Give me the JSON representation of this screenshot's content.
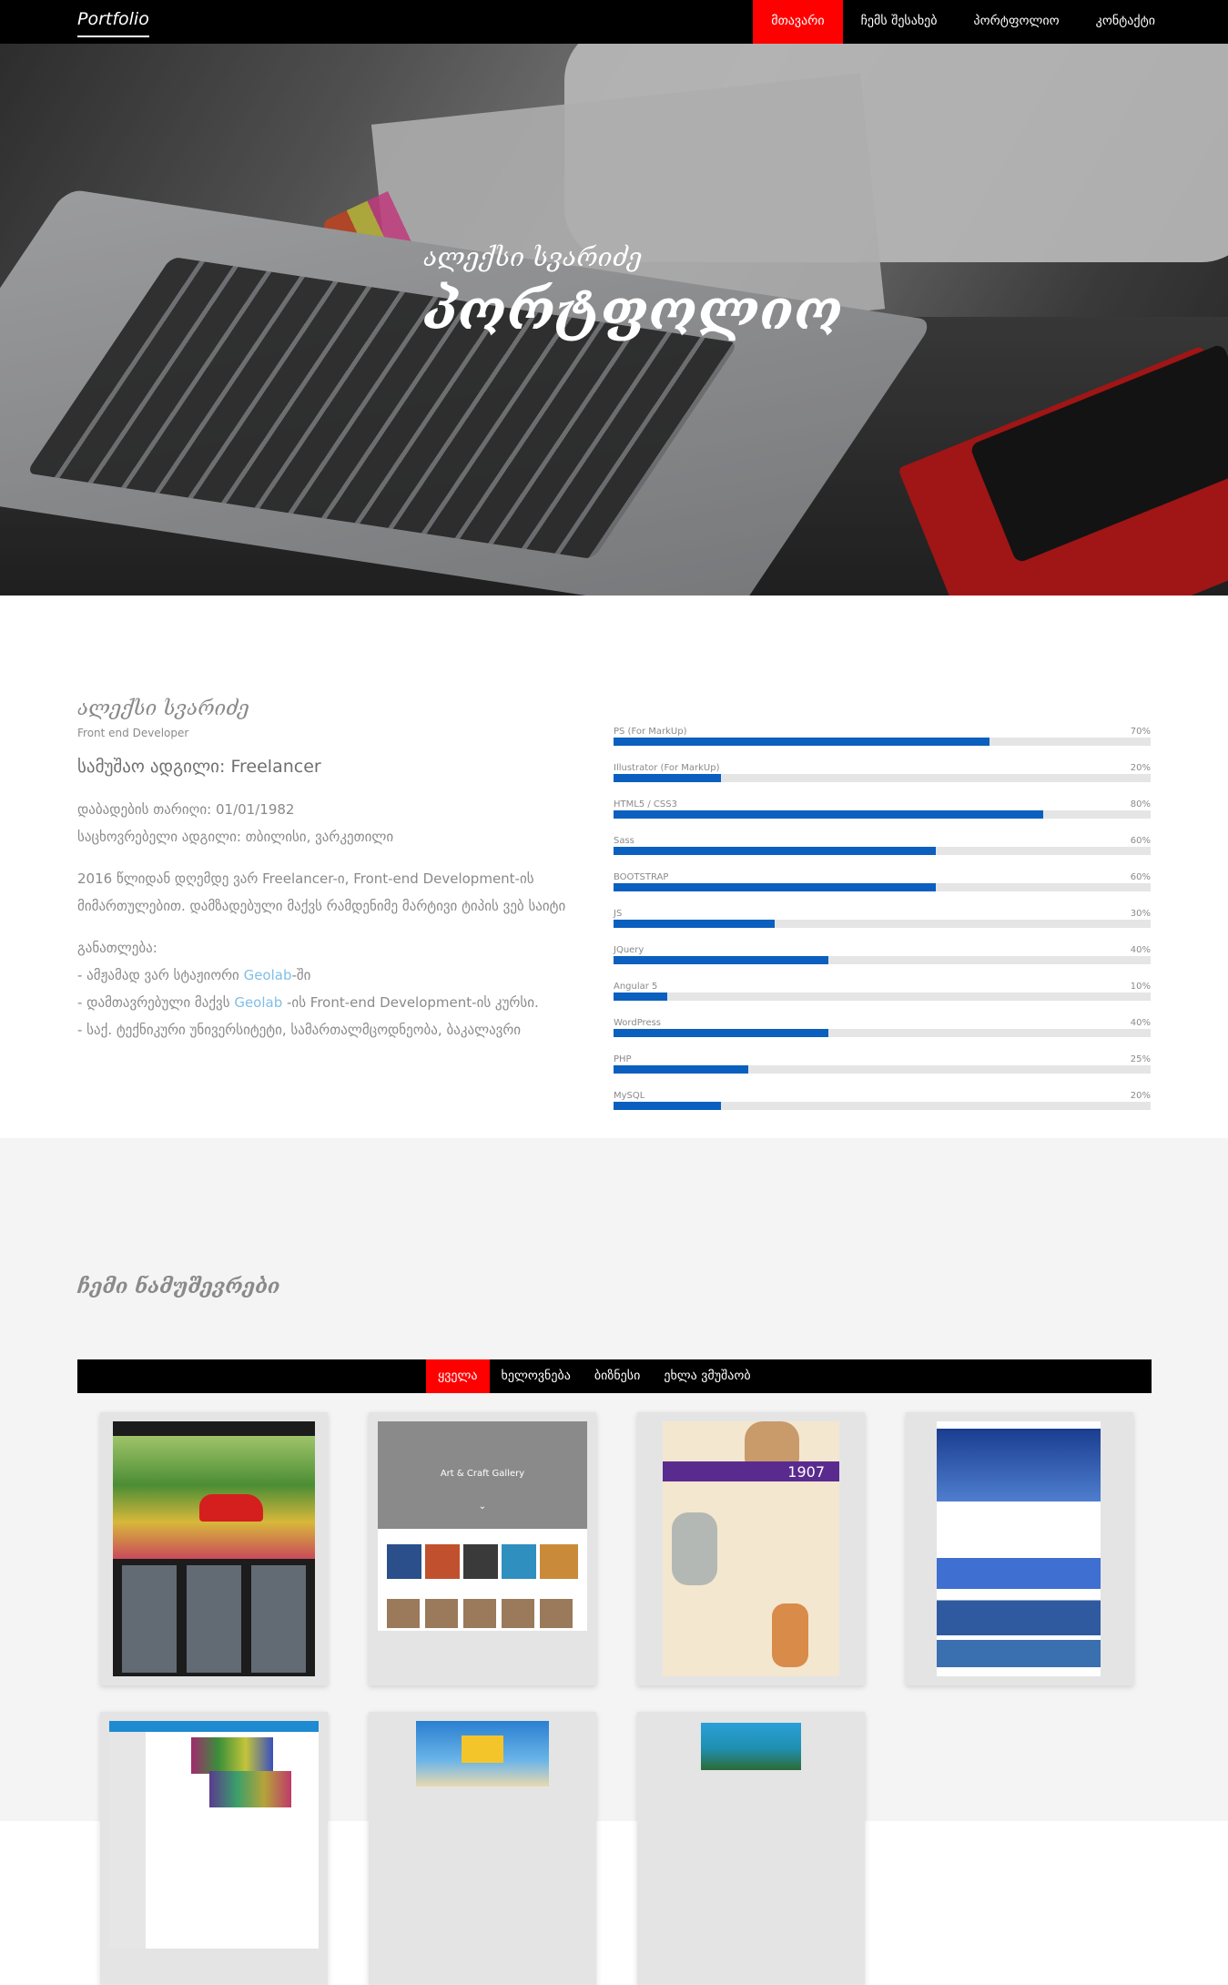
{
  "nav": {
    "brand": "Portfolio",
    "items": [
      "მთავარი",
      "ჩემს შესახებ",
      "პორტფოლიო",
      "კონტაქტი"
    ],
    "active_index": 0
  },
  "hero": {
    "subtitle": "ალექსი სვარიძე",
    "title": "პორტფოლიო"
  },
  "about": {
    "name": "ალექსი სვარიძე",
    "role": "Front end Developer",
    "work_label": "სამუშაო ადგილი:",
    "work_value": "Freelancer",
    "birth": "დაბადების თარიღი: 01/01/1982",
    "residence": "საცხოვრებელი ადგილი: თბილისი, ვარკეთილი",
    "bio_line1": "2016 წლიდან დღემდე ვარ Freelancer-ი, Front-end Development-ის",
    "bio_line2": "მიმართულებით. დამზადებული მაქვს რამდენიმე მარტივი ტიპის ვებ საიტი",
    "education_label": "განათლება:",
    "edu1_pre": "- ამჟამად ვარ სტაჟიორი ",
    "edu1_link": "Geolab",
    "edu1_post": "-ში",
    "edu2_pre": "- დამთავრებული მაქვს ",
    "edu2_link": "Geolab",
    "edu2_post": " -ის Front-end Development-ის კურსი.",
    "edu3": "- საქ. ტექნიკური უნივერსიტეტი, სამართალმცოდნეობა, ბაკალავრი"
  },
  "skills": [
    {
      "label": "PS (For MarkUp)",
      "pct_text": "70%",
      "value": 70
    },
    {
      "label": "Illustrator (For MarkUp)",
      "pct_text": "20%",
      "value": 20
    },
    {
      "label": "HTML5 / CSS3",
      "pct_text": "80%",
      "value": 80
    },
    {
      "label": "Sass",
      "pct_text": "60%",
      "value": 60
    },
    {
      "label": "BOOTSTRAP",
      "pct_text": "60%",
      "value": 60
    },
    {
      "label": "JS",
      "pct_text": "30%",
      "value": 30
    },
    {
      "label": "JQuery",
      "pct_text": "40%",
      "value": 40
    },
    {
      "label": "Angular 5",
      "pct_text": "10%",
      "value": 10
    },
    {
      "label": "WordPress",
      "pct_text": "40%",
      "value": 40
    },
    {
      "label": "PHP",
      "pct_text": "25%",
      "value": 25
    },
    {
      "label": "MySQL",
      "pct_text": "20%",
      "value": 20
    }
  ],
  "works": {
    "title": "ჩემი ნამუშევრები",
    "filters": [
      "ყველა",
      "ხელოვნება",
      "ბიზნესი",
      "ეხლა ვმუშაობ"
    ],
    "active_filter": 0,
    "gallery_header": "Art & Craft Gallery",
    "gallery_chevron": "⌄",
    "number_1907": "1907"
  },
  "colors": {
    "accent": "#ff0000",
    "bar": "#0a5fbf",
    "link": "#7fbfe6",
    "nav_bg": "#000000"
  }
}
